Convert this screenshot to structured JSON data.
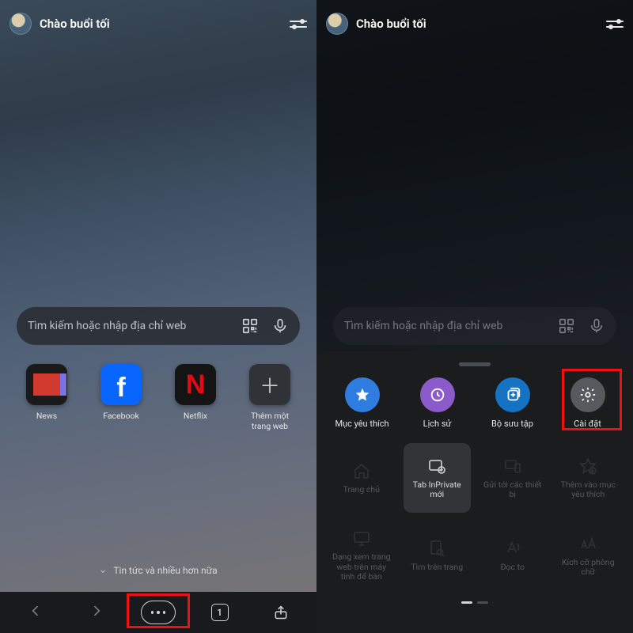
{
  "left": {
    "greeting": "Chào buổi tối",
    "search_placeholder": "Tìm kiếm hoặc nhập địa chỉ web",
    "tiles": [
      {
        "label": "News"
      },
      {
        "label": "Facebook"
      },
      {
        "label": "Netflix"
      },
      {
        "label": "Thêm một trang web"
      }
    ],
    "news_more": "Tin tức và nhiều hơn nữa",
    "tab_count": "1"
  },
  "right": {
    "greeting": "Chào buổi tối",
    "search_placeholder": "Tìm kiếm hoặc nhập địa chỉ web",
    "menu_top": [
      {
        "label": "Mục yêu thích"
      },
      {
        "label": "Lịch sử"
      },
      {
        "label": "Bộ sưu tập"
      },
      {
        "label": "Cài đặt"
      }
    ],
    "grid": [
      {
        "label": "Trang chủ"
      },
      {
        "label": "Tab InPrivate mới"
      },
      {
        "label": "Gửi tới các thiết bị"
      },
      {
        "label": "Thêm vào mục yêu thích"
      },
      {
        "label": "Dạng xem trang web trên máy tính để bàn"
      },
      {
        "label": "Tìm trên trang"
      },
      {
        "label": "Đọc to"
      },
      {
        "label": "Kích cỡ phông chữ"
      }
    ]
  }
}
